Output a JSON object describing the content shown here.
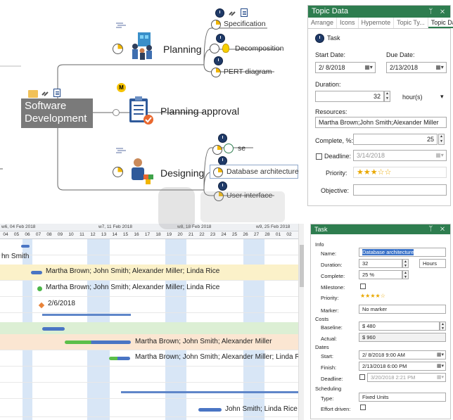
{
  "mindmap": {
    "central": "Software Development",
    "branches": [
      {
        "label": "Planning",
        "children": [
          "Specification",
          "Decomposition",
          "PERT diagram"
        ]
      },
      {
        "label": "Planning approval",
        "children": []
      },
      {
        "label": "Designing",
        "children": [
          "se",
          "Database architecture",
          "User interface"
        ]
      }
    ]
  },
  "topic_panel": {
    "title": "Topic Data",
    "controls": "ᛘ ✕",
    "tabs": [
      "Arrange",
      "Icons",
      "Hypernote",
      "Topic Ty...",
      "Topic Data"
    ],
    "task_label": "Task",
    "start_label": "Start Date:",
    "due_label": "Due Date:",
    "start_value": "2/ 8/2018",
    "due_value": "2/13/2018",
    "duration_label": "Duration:",
    "duration_value": "32",
    "duration_unit": "hour(s)",
    "resources_label": "Resources:",
    "resources_value": "Martha Brown;John Smith;Alexander Miller",
    "complete_label": "Complete, %:",
    "complete_value": "25",
    "deadline_label": "Deadline:",
    "deadline_value": "3/14/2018",
    "priority_label": "Priority:",
    "priority_value": "★★★☆☆",
    "objective_label": "Objective:"
  },
  "gantt": {
    "weeks": [
      "w6, 04 Feb 2018",
      "w7, 11 Feb 2018",
      "w8, 18 Feb 2018",
      "w9, 25 Feb 2018"
    ],
    "days": [
      "04",
      "05",
      "06",
      "07",
      "08",
      "09",
      "10",
      "11",
      "12",
      "13",
      "14",
      "15",
      "16",
      "17",
      "18",
      "19",
      "20",
      "21",
      "22",
      "23",
      "24",
      "25",
      "26",
      "27",
      "28",
      "01",
      "02"
    ],
    "rows": {
      "r1": "hn Smith",
      "r2": "Martha Brown; John Smith; Alexander Miller; Linda Rice",
      "r3": "Martha Brown; John Smith; Alexander Miller; Linda Rice",
      "r4": "2/6/2018",
      "r8": "Martha Brown; John Smith; Alexander Miller",
      "r9": "Martha Brown; John Smith; Alexander Miller; Linda Rice",
      "r12": "John Smith; Linda Rice"
    }
  },
  "task_panel": {
    "title": "Task",
    "controls": "ᛘ ✕",
    "sections": {
      "info": "Info",
      "costs": "Costs",
      "dates": "Dates",
      "scheduling": "Scheduling"
    },
    "name_label": "Name:",
    "name_value": "Database architecture",
    "duration_label": "Duration:",
    "duration_value": "32",
    "duration_unit": "Hours",
    "complete_label": "Complete:",
    "complete_value": "25 %",
    "milestone_label": "Milestone:",
    "priority_label": "Priority:",
    "priority_value": "★★★★☆",
    "marker_label": "Marker:",
    "marker_value": "No marker",
    "baseline_label": "Baseline:",
    "baseline_value": "$ 480",
    "actual_label": "Actual:",
    "actual_value": "$ 960",
    "start_label": "Start:",
    "start_value": "2/ 8/2018  9:00 AM",
    "finish_label": "Finish:",
    "finish_value": "2/13/2018  6:00 PM",
    "deadline_label": "Deadline:",
    "deadline_value": "3/20/2018  2:21 PM",
    "type_label": "Type:",
    "type_value": "Fixed Units",
    "effort_label": "Effort driven:"
  },
  "colors": {
    "panel_title": "#2e7d4f",
    "gantt_bar": "#4a75c4",
    "highlight_col": "#d8e6f6"
  }
}
